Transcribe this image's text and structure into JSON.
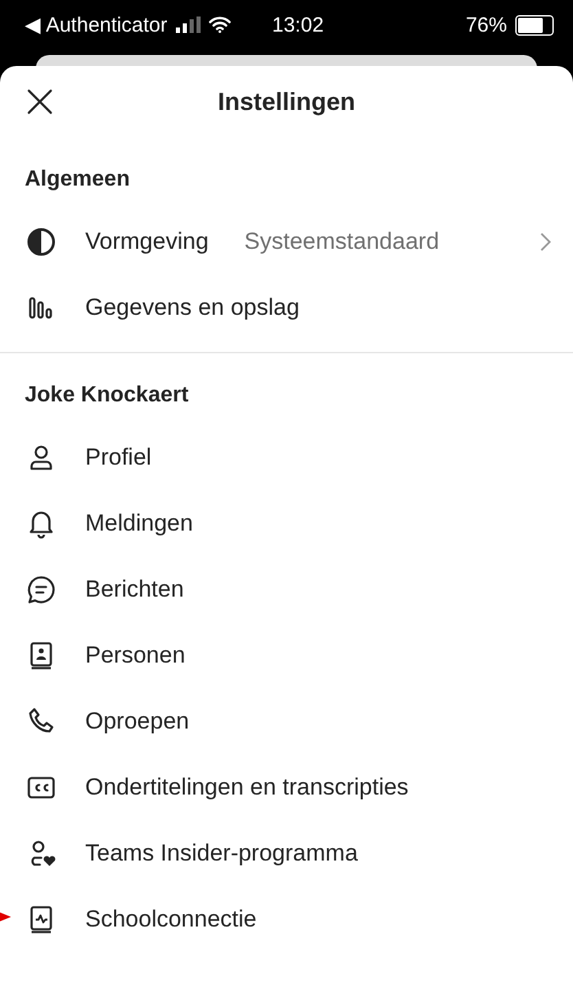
{
  "status_bar": {
    "back_app": "◀ Authenticator",
    "time": "13:02",
    "battery": "76%"
  },
  "header": {
    "title": "Instellingen"
  },
  "sections": [
    {
      "title": "Algemeen",
      "items": [
        {
          "kind": "appearance",
          "label": "Vormgeving",
          "value": "Systeemstandaard"
        },
        {
          "kind": "storage",
          "label": "Gegevens en opslag"
        }
      ]
    },
    {
      "title": "Joke Knockaert",
      "items": [
        {
          "kind": "profile",
          "label": "Profiel"
        },
        {
          "kind": "notifications",
          "label": "Meldingen"
        },
        {
          "kind": "messages",
          "label": "Berichten"
        },
        {
          "kind": "contacts",
          "label": "Personen"
        },
        {
          "kind": "calls",
          "label": "Oproepen"
        },
        {
          "kind": "captions",
          "label": "Ondertitelingen en transcripties"
        },
        {
          "kind": "insider",
          "label": "Teams Insider-programma"
        },
        {
          "kind": "school",
          "label": "Schoolconnectie",
          "highlighted": true
        }
      ]
    }
  ]
}
